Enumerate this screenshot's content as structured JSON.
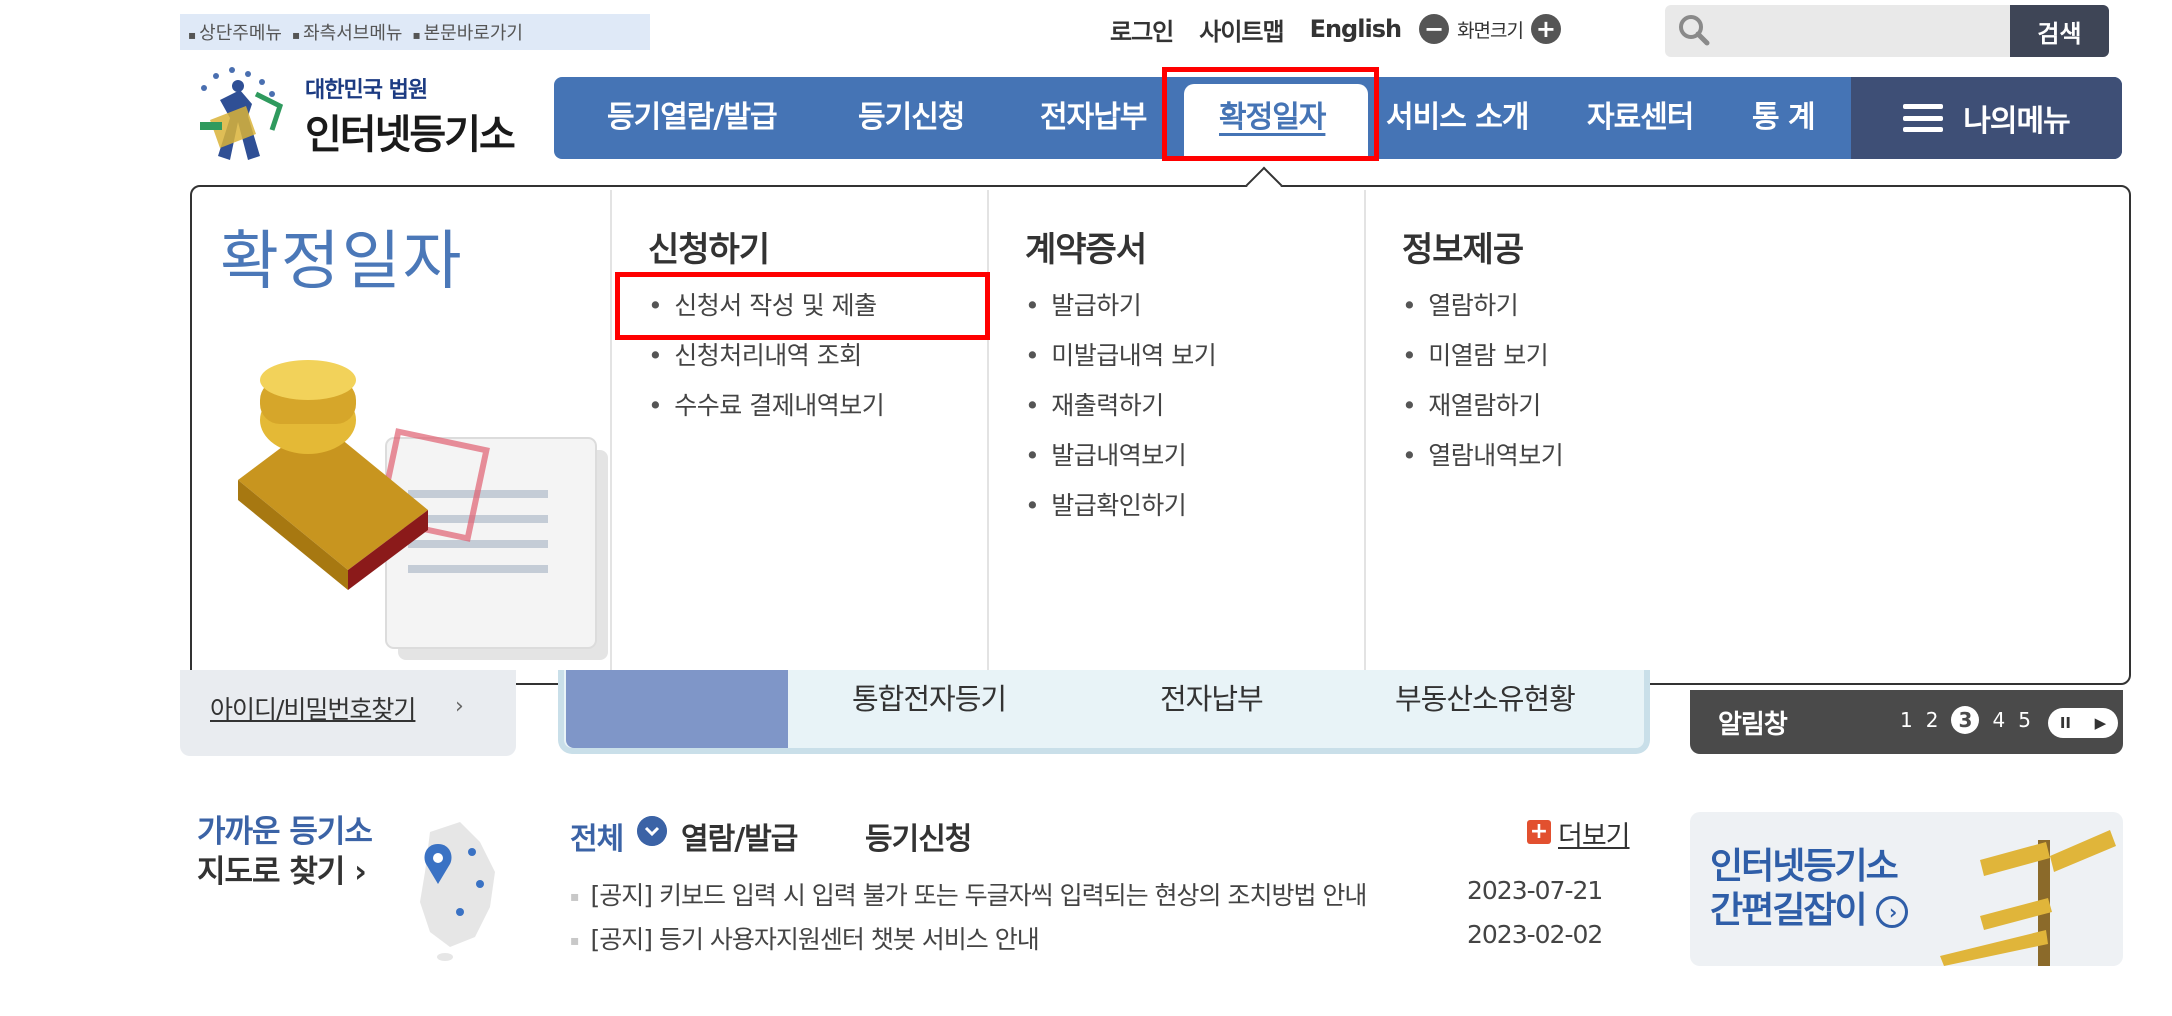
{
  "skip_links": [
    "상단주메뉴",
    "좌측서브메뉴",
    "본문바로가기"
  ],
  "util": {
    "login": "로그인",
    "sitemap": "사이트맵",
    "english": "English",
    "zoom_minus": "−",
    "zoom_label": "화면크기",
    "zoom_plus": "+"
  },
  "search": {
    "value": "",
    "button": "검색"
  },
  "logo": {
    "small": "대한민국 법원",
    "big": "인터넷등기소"
  },
  "nav": {
    "items": [
      "등기열람/발급",
      "등기신청",
      "전자납부",
      "확정일자",
      "서비스 소개",
      "자료센터",
      "통 계"
    ],
    "active": "확정일자",
    "my_menu": "나의메뉴"
  },
  "mega_menu": {
    "title": "확정일자",
    "columns": [
      {
        "title": "신청하기",
        "items": [
          "신청서 작성 및 제출",
          "신청처리내역 조회",
          "수수료 결제내역보기"
        ]
      },
      {
        "title": "계약증서",
        "items": [
          "발급하기",
          "미발급내역 보기",
          "재출력하기",
          "발급내역보기",
          "발급확인하기"
        ]
      },
      {
        "title": "정보제공",
        "items": [
          "열람하기",
          "미열람 보기",
          "재열람하기",
          "열람내역보기"
        ]
      }
    ]
  },
  "login_box": {
    "find_id": "아이디/비밀번호찾기",
    "arrow": "›"
  },
  "quick_links": [
    "통합전자등기",
    "전자납부",
    "부동산소유현황"
  ],
  "alert": {
    "label": "알림창",
    "pages": [
      "1",
      "2",
      "3",
      "4",
      "5"
    ],
    "current": "3",
    "pause": "II",
    "next": "▶"
  },
  "nearest": {
    "line1": "가까운 등기소",
    "line2": "지도로 찾기 ›"
  },
  "notice": {
    "tabs": [
      "전체",
      "열람/발급",
      "등기신청"
    ],
    "more": "더보기",
    "rows": [
      {
        "title": "[공지] 키보드 입력 시 입력 불가 또는 두글자씩 입력되는 현상의 조치방법 안내",
        "date": "2023-07-21"
      },
      {
        "title": "[공지] 등기 사용자지원센터 챗봇 서비스 안내",
        "date": "2023-02-02"
      }
    ]
  },
  "banner": {
    "line1": "인터넷등기소",
    "line2": "간편길잡이"
  },
  "colors": {
    "nav": "#4574b5",
    "my_menu": "#3e4f76",
    "highlight": "#ff0000",
    "accent": "#4b78b8"
  }
}
